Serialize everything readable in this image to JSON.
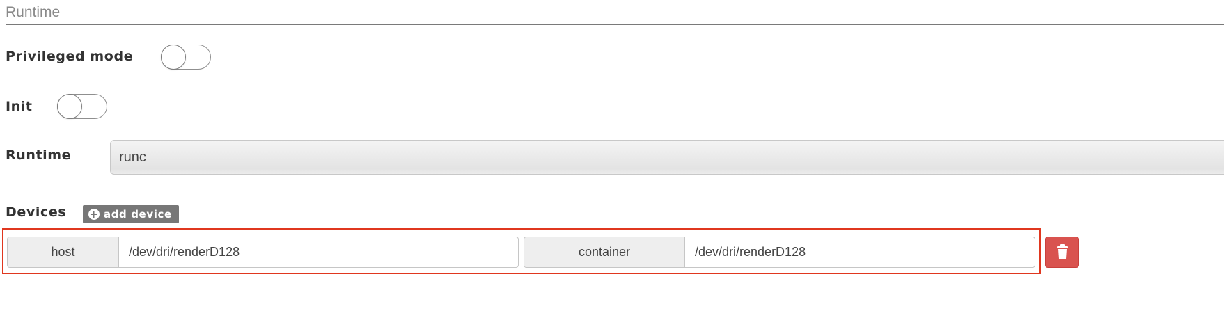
{
  "section": {
    "title": "Runtime"
  },
  "privileged": {
    "label": "Privileged mode",
    "enabled": false
  },
  "init": {
    "label": "Init",
    "enabled": false
  },
  "runtime": {
    "label": "Runtime",
    "value": "runc"
  },
  "devices": {
    "label": "Devices",
    "add_label": "add device",
    "add_icon": "plus-circle-icon",
    "items": [
      {
        "host_label": "host",
        "host_value": "/dev/dri/renderD128",
        "container_label": "container",
        "container_value": "/dev/dri/renderD128",
        "delete_icon": "trash-icon"
      }
    ]
  },
  "colors": {
    "highlight_border": "#e0371f",
    "delete_button": "#d9534f",
    "add_button": "#777777"
  }
}
